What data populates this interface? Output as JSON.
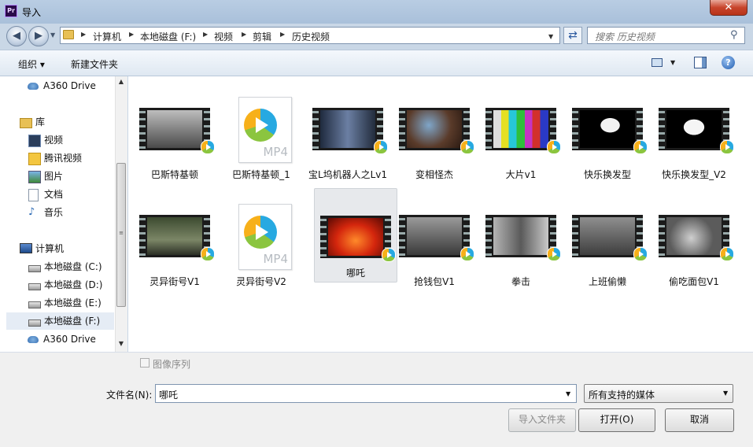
{
  "window": {
    "title": "导入",
    "app_icon": "Pr",
    "close": "✕"
  },
  "address": {
    "crumbs": [
      "计算机",
      "本地磁盘 (F:)",
      "视频",
      "剪辑",
      "历史视频"
    ],
    "search_placeholder": "搜索 历史视频"
  },
  "toolbar": {
    "organize": "组织 ▾",
    "new_folder": "新建文件夹"
  },
  "sidebar": {
    "items": [
      {
        "label": "A360 Drive",
        "icon": "cloud-icon"
      },
      {
        "label": "库",
        "icon": "library-icon"
      },
      {
        "label": "视频",
        "icon": "video-icon"
      },
      {
        "label": "腾讯视频",
        "icon": "tencent-video-icon"
      },
      {
        "label": "图片",
        "icon": "picture-icon"
      },
      {
        "label": "文档",
        "icon": "document-icon"
      },
      {
        "label": "音乐",
        "icon": "music-icon"
      },
      {
        "label": "计算机",
        "icon": "computer-icon"
      },
      {
        "label": "本地磁盘 (C:)",
        "icon": "drive-icon"
      },
      {
        "label": "本地磁盘 (D:)",
        "icon": "drive-icon"
      },
      {
        "label": "本地磁盘 (E:)",
        "icon": "drive-icon"
      },
      {
        "label": "本地磁盘 (F:)",
        "icon": "drive-icon",
        "selected": true
      },
      {
        "label": "A360 Drive",
        "icon": "cloud-icon"
      }
    ]
  },
  "files": [
    {
      "name": "巴斯特基顿",
      "kind": "video",
      "frame": "#7d7d7d"
    },
    {
      "name": "巴斯特基顿_1",
      "kind": "mp4",
      "ext": "MP4"
    },
    {
      "name": "宝L坞机器人之Lv1",
      "kind": "video",
      "frame": "#3b4a63"
    },
    {
      "name": "变相怪杰",
      "kind": "video",
      "frame": "#5a3b2a"
    },
    {
      "name": "大片v1",
      "kind": "video",
      "frame": "testcard"
    },
    {
      "name": "快乐换发型",
      "kind": "video",
      "frame": "portrait"
    },
    {
      "name": "快乐换发型_V2",
      "kind": "video",
      "frame": "portrait"
    },
    {
      "name": "灵异街号V1",
      "kind": "video",
      "frame": "#4f5a3e"
    },
    {
      "name": "灵异街号V2",
      "kind": "mp4",
      "ext": "MP4"
    },
    {
      "name": "哪吒",
      "kind": "video",
      "frame": "fire",
      "selected": true
    },
    {
      "name": "抢钱包V1",
      "kind": "video",
      "frame": "#6b6b6b"
    },
    {
      "name": "拳击",
      "kind": "video",
      "frame": "#8a8a8a"
    },
    {
      "name": "上班偷懒",
      "kind": "video",
      "frame": "#5e5e5e"
    },
    {
      "name": "偷吃面包V1",
      "kind": "video",
      "frame": "#777777"
    }
  ],
  "bottom": {
    "image_sequence": "图像序列",
    "filename_label": "文件名(N):",
    "filename_value": "哪吒",
    "filetype_value": "所有支持的媒体",
    "import_folder": "导入文件夹",
    "open": "打开(O)",
    "cancel": "取消"
  },
  "colors": {
    "accent": "#1f5cb0",
    "close": "#c8452c"
  }
}
